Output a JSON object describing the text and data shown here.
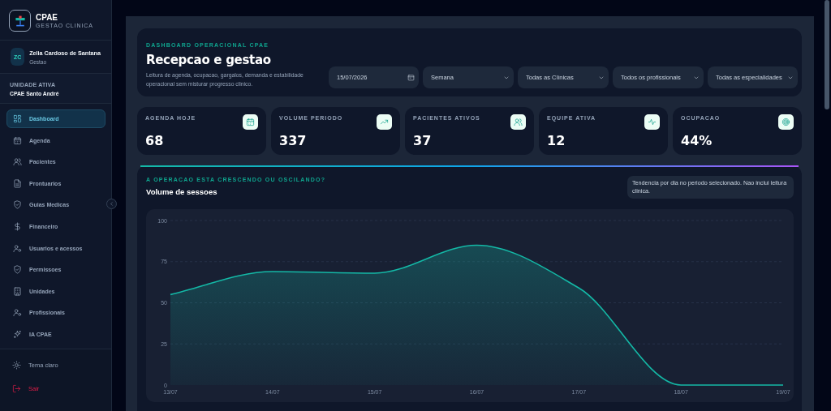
{
  "sidebar": {
    "brand": {
      "name": "CPAE",
      "tagline": "GESTAO CLINICA"
    },
    "user": {
      "initials": "ZC",
      "name": "Zelia Cardoso de Santana",
      "role": "Gestao"
    },
    "unit": {
      "label": "UNIDADE ATIVA",
      "value": "CPAE Santo André"
    },
    "items": [
      {
        "label": "Dashboard",
        "selected": true
      },
      {
        "label": "Agenda",
        "selected": false
      },
      {
        "label": "Pacientes",
        "selected": false
      },
      {
        "label": "Prontuarios",
        "selected": false
      },
      {
        "label": "Guias Medicas",
        "selected": false
      },
      {
        "label": "Financeiro",
        "selected": false
      },
      {
        "label": "Usuarios e acessos",
        "selected": false
      },
      {
        "label": "Permissoes",
        "selected": false
      },
      {
        "label": "Unidades",
        "selected": false
      },
      {
        "label": "Profissionais",
        "selected": false
      },
      {
        "label": "IA CPAE",
        "selected": false
      }
    ],
    "footer": [
      {
        "kind": "theme",
        "label": "Tema claro"
      },
      {
        "kind": "logout",
        "label": "Sair"
      }
    ]
  },
  "header": {
    "eyebrow": "DASHBOARD OPERACIONAL CPAE",
    "title": "Recepcao e gestao",
    "subtitle": "Leitura de agenda, ocupacao, gargalos, demanda e estabilidade operacional sem misturar progresso clinico.",
    "filters": [
      {
        "kind": "date",
        "value": "15/07/2026"
      },
      {
        "kind": "select",
        "value": "Semana"
      },
      {
        "kind": "select",
        "value": "Todas as Clínicas"
      },
      {
        "kind": "select",
        "value": "Todos os profissionais"
      },
      {
        "kind": "select",
        "value": "Todas as especialidades"
      }
    ]
  },
  "kpis": [
    {
      "label": "AGENDA HOJE",
      "value": "68"
    },
    {
      "label": "VOLUME PERIODO",
      "value": "337"
    },
    {
      "label": "PACIENTES ATIVOS",
      "value": "37"
    },
    {
      "label": "EQUIPE ATIVA",
      "value": "12"
    },
    {
      "label": "OCUPACAO",
      "value": "44%"
    }
  ],
  "sessions": {
    "eyebrow": "A OPERACAO ESTA CRESCENDO OU OSCILANDO?",
    "note": "Tendencia por dia no periodo selecionado. Nao inclui leitura clinica.",
    "chart_data": {
      "type": "area",
      "title": "Volume de sessoes",
      "categories": [
        "13/07",
        "14/07",
        "15/07",
        "16/07",
        "17/07",
        "18/07",
        "19/07"
      ],
      "values": [
        55,
        69,
        68,
        85,
        59,
        0,
        0
      ],
      "ylim": [
        0,
        100
      ],
      "yticks": [
        0,
        25,
        50,
        75,
        100
      ],
      "grid": true
    }
  }
}
